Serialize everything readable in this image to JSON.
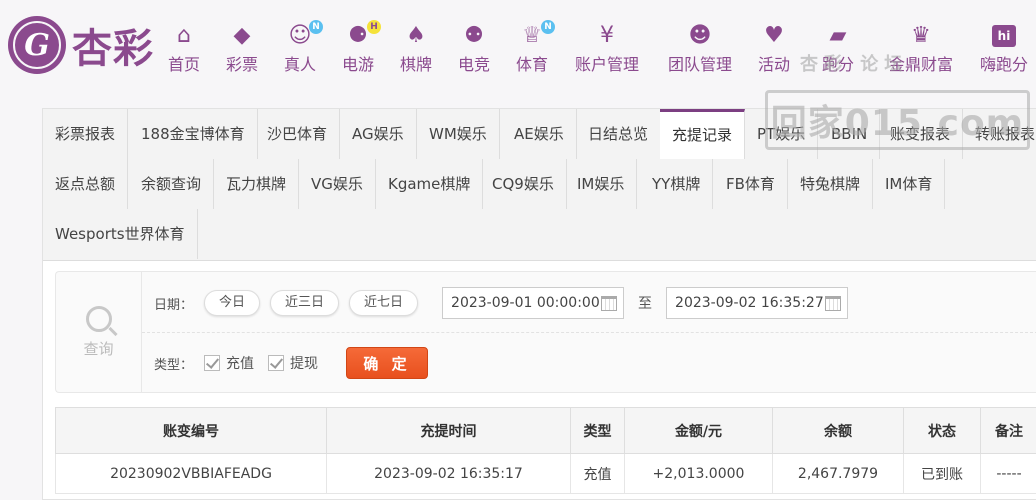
{
  "brand": {
    "logo_glyph": "G",
    "name": "杏彩",
    "color": "#8b4a8e"
  },
  "nav": [
    {
      "label": "首页",
      "icon": "home-icon",
      "glyph": "⌂"
    },
    {
      "label": "彩票",
      "icon": "lottery-icon",
      "glyph": "◆"
    },
    {
      "label": "真人",
      "icon": "live-dealer-icon",
      "glyph": "☺",
      "badge": "N"
    },
    {
      "label": "电游",
      "icon": "gamepad-icon",
      "glyph": "⚈",
      "badge": "H"
    },
    {
      "label": "棋牌",
      "icon": "cards-icon",
      "glyph": "♠"
    },
    {
      "label": "电竞",
      "icon": "esports-icon",
      "glyph": "⚉"
    },
    {
      "label": "体育",
      "icon": "trophy-icon",
      "glyph": "♕",
      "badge": "N"
    },
    {
      "label": "账户管理",
      "icon": "account-icon",
      "glyph": "¥"
    },
    {
      "label": "团队管理",
      "icon": "team-icon",
      "glyph": "☻"
    },
    {
      "label": "活动",
      "icon": "gift-icon",
      "glyph": "♥"
    },
    {
      "label": "跑分",
      "icon": "car-icon",
      "glyph": "▰"
    },
    {
      "label": "金鼎财富",
      "icon": "wealth-icon",
      "glyph": "♛"
    },
    {
      "label": "嗨跑分",
      "icon": "hi-icon",
      "glyph": "hi"
    }
  ],
  "watermark": {
    "line1": "杏彩 论坛",
    "line2": "回家015.com"
  },
  "tabs": [
    {
      "label": "彩票报表"
    },
    {
      "label": "188金宝博体育"
    },
    {
      "label": "沙巴体育"
    },
    {
      "label": "AG娱乐"
    },
    {
      "label": "WM娱乐"
    },
    {
      "label": "AE娱乐"
    },
    {
      "label": "日结总览"
    },
    {
      "label": "充提记录",
      "active": true
    },
    {
      "label": "PT娱乐"
    },
    {
      "label": "BBIN"
    },
    {
      "label": "账变报表"
    },
    {
      "label": "转账报表"
    },
    {
      "label": "返点总额"
    },
    {
      "label": "余额查询"
    },
    {
      "label": "瓦力棋牌"
    },
    {
      "label": "VG娱乐"
    },
    {
      "label": "Kgame棋牌"
    },
    {
      "label": "CQ9娱乐"
    },
    {
      "label": "IM娱乐"
    },
    {
      "label": "YY棋牌"
    },
    {
      "label": "FB体育"
    },
    {
      "label": "特兔棋牌"
    },
    {
      "label": "IM体育"
    },
    {
      "label": "Wesports世界体育"
    }
  ],
  "query": {
    "side_label": "查询",
    "date_label": "日期：",
    "quick": [
      "今日",
      "近三日",
      "近七日"
    ],
    "start": "2023-09-01 00:00:00",
    "to": "至",
    "end": "2023-09-02 16:35:27",
    "type_label": "类型：",
    "types": [
      "充值",
      "提现"
    ],
    "confirm": "确 定"
  },
  "table": {
    "headers": [
      "账变编号",
      "充提时间",
      "类型",
      "金额/元",
      "余额",
      "状态",
      "备注"
    ],
    "rows": [
      [
        "20230902VBBIAFEADG",
        "2023-09-02 16:35:17",
        "充值",
        "+2,013.0000",
        "2,467.7979",
        "已到账",
        "-----"
      ]
    ]
  }
}
